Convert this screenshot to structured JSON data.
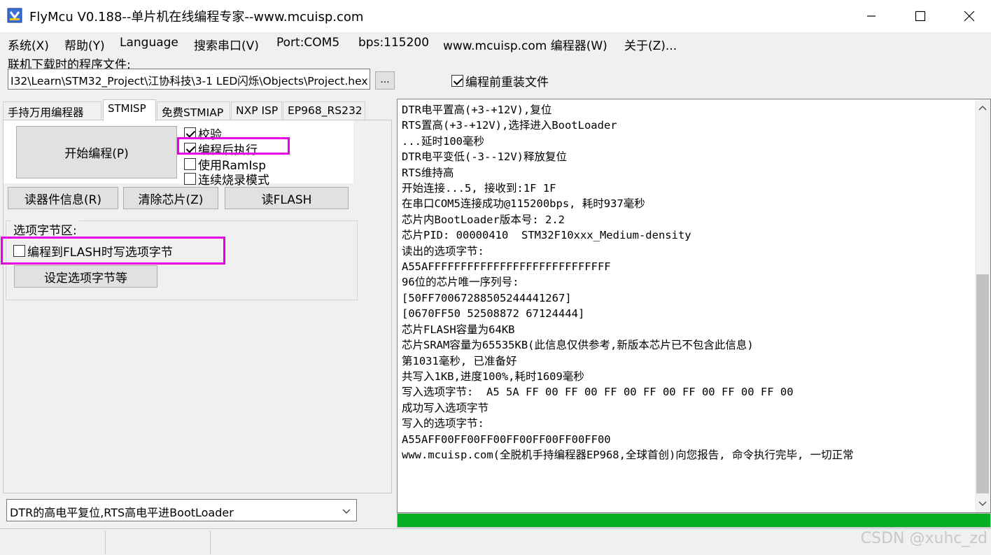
{
  "window": {
    "title": "FlyMcu V0.188--单片机在线编程专家--www.mcuisp.com"
  },
  "menu": [
    "系统(X)",
    "帮助(Y)",
    "Language",
    "搜索串口(V)",
    "Port:COM5",
    "bps:115200",
    "www.mcuisp.com 编程器(W)",
    "关于(Z)..."
  ],
  "file": {
    "label": "联机下载时的程序文件:",
    "path": "I32\\Learn\\STM32_Project\\江协科技\\3-1 LED闪烁\\Objects\\Project.hex",
    "browse_label": "...",
    "reload_label": "编程前重装文件",
    "reload_checked": true
  },
  "tabs": [
    "手持万用编程器",
    "STMISP",
    "免费STMIAP",
    "NXP ISP",
    "EP968_RS232"
  ],
  "stmisp": {
    "start_label": "开始编程(P)",
    "verify_label": "校验",
    "verify_checked": true,
    "exec_label": "编程后执行",
    "exec_checked": true,
    "ramisp_label": "使用RamIsp",
    "ramisp_checked": false,
    "continuous_label": "连续烧录模式",
    "continuous_checked": false,
    "read_info_label": "读器件信息(R)",
    "erase_label": "清除芯片(Z)",
    "read_flash_label": "读FLASH",
    "option_group_label": "选项字节区:",
    "write_option_label": "编程到FLASH时写选项字节",
    "write_option_checked": false,
    "set_option_label": "设定选项字节等"
  },
  "reset_mode": "DTR的高电平复位,RTS高电平进BootLoader",
  "log_text": "DTR电平置高(+3-+12V),复位\nRTS置高(+3-+12V),选择进入BootLoader\n...延时100毫秒\nDTR电平变低(-3--12V)释放复位\nRTS维持高\n开始连接...5, 接收到:1F 1F\n在串口COM5连接成功@115200bps, 耗时937毫秒\n芯片内BootLoader版本号: 2.2\n芯片PID: 00000410  STM32F10xxx_Medium-density\n读出的选项字节:\nA55AFFFFFFFFFFFFFFFFFFFFFFFFFFFF\n96位的芯片唯一序列号:\n[50FF70067288505244441267]\n[0670FF50 52508872 67124444]\n芯片FLASH容量为64KB\n芯片SRAM容量为65535KB(此信息仅供参考,新版本芯片已不包含此信息)\n第1031毫秒, 已准备好\n共写入1KB,进度100%,耗时1609毫秒\n写入选项字节:  A5 5A FF 00 FF 00 FF 00 FF 00 FF 00 FF 00 FF 00\n成功写入选项字节\n写入的选项字节:\nA55AFF00FF00FF00FF00FF00FF00FF00\nwww.mcuisp.com(全脱机手持编程器EP968,全球首创)向您报告, 命令执行完毕, 一切正常",
  "progress": 1.0,
  "watermark": "CSDN @xuhc_zd",
  "colors": {
    "highlight": "#e600e6",
    "progress": "#06b025"
  },
  "icons": {
    "app": "flymcu-app-icon",
    "minimize": "minimize-icon",
    "maximize": "maximize-icon",
    "close": "close-icon",
    "dropdown": "chevron-down-icon",
    "scroll_up": "chevron-up-icon",
    "scroll_down": "chevron-down-icon"
  }
}
